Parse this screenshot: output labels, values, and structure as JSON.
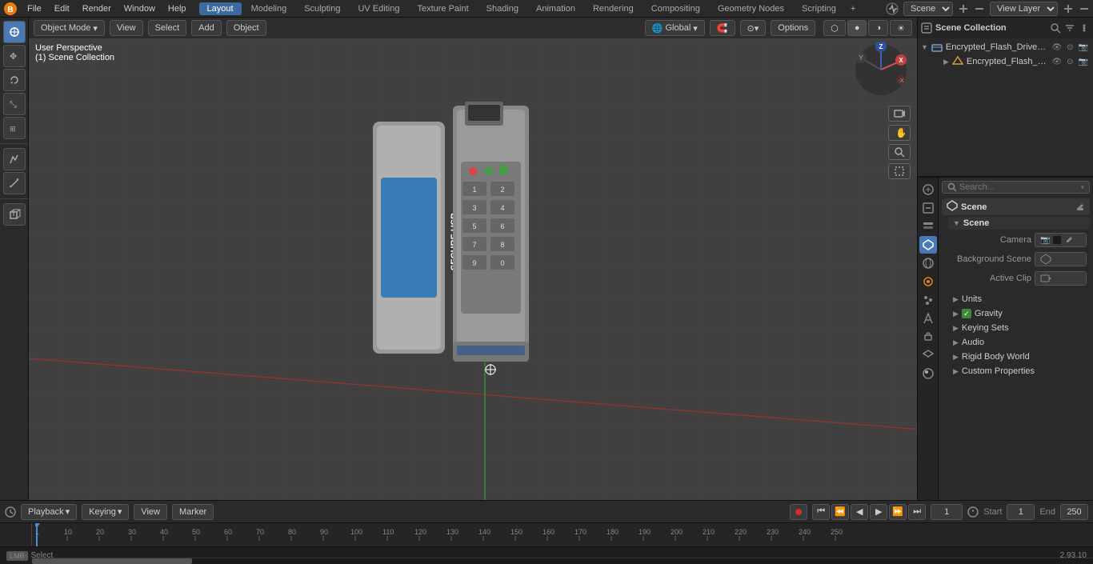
{
  "app": {
    "title": "Blender",
    "version": "2.93.10"
  },
  "topmenu": {
    "items": [
      "File",
      "Edit",
      "Render",
      "Window",
      "Help"
    ],
    "workspace_tabs": [
      "Layout",
      "Modeling",
      "Sculpting",
      "UV Editing",
      "Texture Paint",
      "Shading",
      "Animation",
      "Rendering",
      "Compositing",
      "Geometry Nodes",
      "Scripting"
    ],
    "active_workspace": "Layout",
    "scene_label": "Scene",
    "view_layer_label": "View Layer"
  },
  "viewport": {
    "mode": "Object Mode",
    "view_label": "View",
    "select_label": "Select",
    "add_label": "Add",
    "object_label": "Object",
    "perspective": "User Perspective",
    "collection": "(1) Scene Collection",
    "transform": "Global",
    "header_btns": [
      "Options"
    ]
  },
  "outliner": {
    "title": "Scene Collection",
    "items": [
      {
        "name": "Encrypted_Flash_Drive_with_l",
        "type": "collection",
        "expanded": true,
        "children": [
          {
            "name": "Encrypted_Flash_Drive_w",
            "type": "mesh"
          }
        ]
      }
    ]
  },
  "properties": {
    "active_tab": "scene",
    "tabs": [
      "render",
      "output",
      "view-layer",
      "scene",
      "world",
      "object",
      "particles",
      "physics",
      "constraints",
      "data",
      "material",
      "shader"
    ],
    "scene_section": {
      "title": "Scene",
      "subsections": [
        {
          "name": "Scene",
          "fields": [
            {
              "label": "Camera",
              "value": ""
            },
            {
              "label": "Background Scene",
              "value": ""
            },
            {
              "label": "Active Clip",
              "value": ""
            }
          ]
        },
        {
          "name": "Units",
          "collapsed": true
        },
        {
          "name": "Gravity",
          "has_checkbox": true,
          "checked": true
        },
        {
          "name": "Keying Sets",
          "collapsed": true
        },
        {
          "name": "Audio",
          "collapsed": true
        },
        {
          "name": "Rigid Body World",
          "collapsed": true
        },
        {
          "name": "Custom Properties",
          "collapsed": true
        }
      ]
    }
  },
  "timeline": {
    "playback_label": "Playback",
    "keying_label": "Keying",
    "view_label": "View",
    "marker_label": "Marker",
    "frame_current": "1",
    "frame_start_label": "Start",
    "frame_start": "1",
    "frame_end_label": "End",
    "frame_end": "250",
    "frame_markers": [
      "1",
      "10",
      "20",
      "30",
      "40",
      "50",
      "60",
      "70",
      "80",
      "90",
      "100",
      "110",
      "120",
      "130",
      "140",
      "150",
      "160",
      "170",
      "180",
      "190",
      "200",
      "210",
      "220",
      "230",
      "240",
      "250"
    ]
  },
  "statusbar": {
    "select_label": "Select",
    "version": "2.93.10"
  }
}
